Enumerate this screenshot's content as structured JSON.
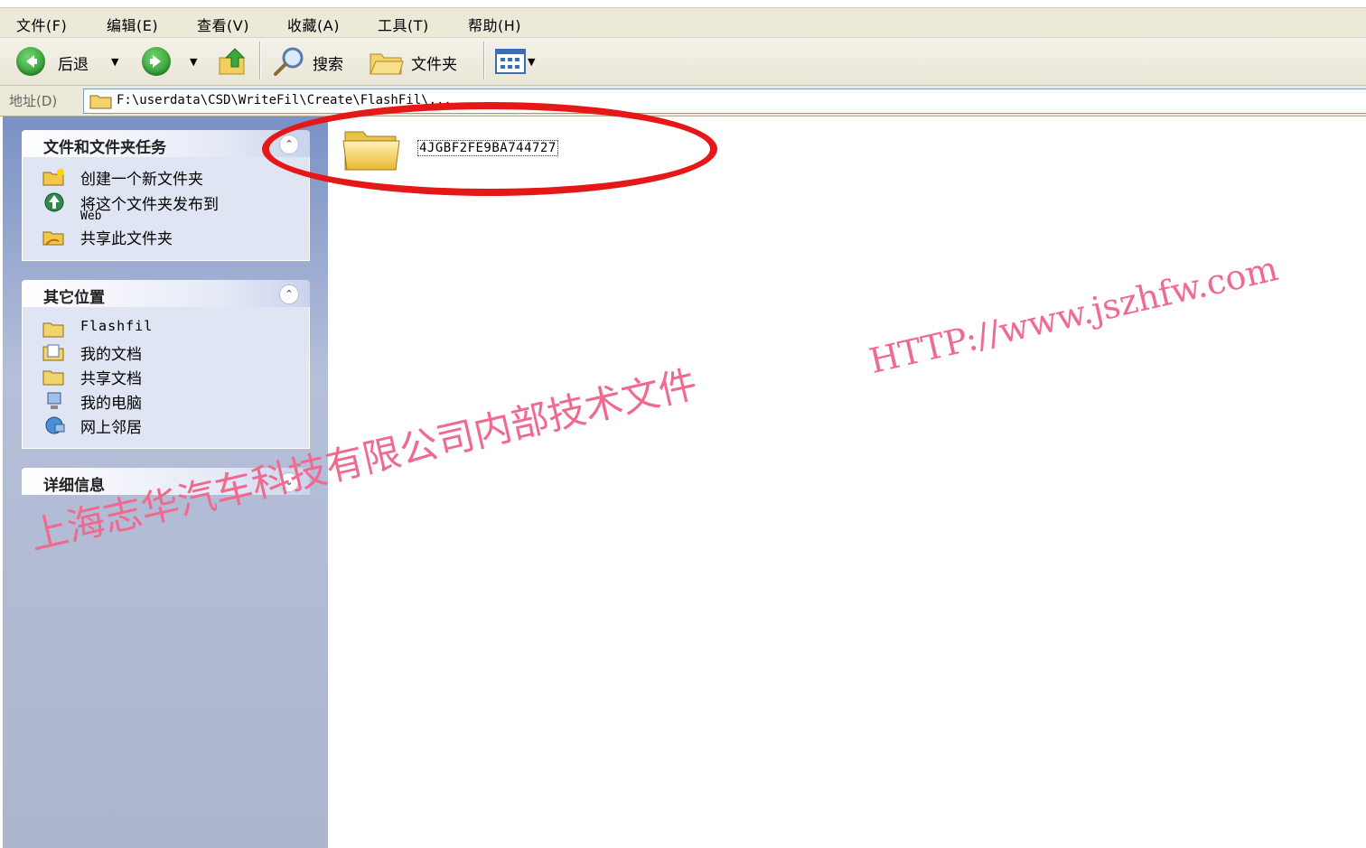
{
  "menu": {
    "file": "文件(F)",
    "edit": "编辑(E)",
    "view": "查看(V)",
    "favorites": "收藏(A)",
    "tools": "工具(T)",
    "help": "帮助(H)"
  },
  "toolbar": {
    "back_label": "后退",
    "search_label": "搜索",
    "folders_label": "文件夹"
  },
  "address": {
    "label": "地址(D)",
    "path": "F:\\userdata\\CSD\\WriteFil\\Create\\FlashFil\\..."
  },
  "sidebar": {
    "tasks_title": "文件和文件夹任务",
    "tasks": [
      {
        "label": "创建一个新文件夹",
        "icon": "new-folder-icon"
      },
      {
        "label": "将这个文件夹发布到",
        "sub": "Web",
        "icon": "publish-web-icon"
      },
      {
        "label": "共享此文件夹",
        "icon": "share-folder-icon"
      }
    ],
    "places_title": "其它位置",
    "places": [
      {
        "label": "Flashfil",
        "icon": "folder-icon"
      },
      {
        "label": "我的文档",
        "icon": "my-documents-icon"
      },
      {
        "label": "共享文档",
        "icon": "folder-icon"
      },
      {
        "label": "我的电脑",
        "icon": "my-computer-icon"
      },
      {
        "label": "网上邻居",
        "icon": "network-icon"
      }
    ],
    "details_title": "详细信息"
  },
  "content": {
    "folder_name": "4JGBF2FE9BA744727"
  },
  "watermark": {
    "company": "上海志华汽车科技有限公司内部技术文件",
    "url": "HTTP://www.jszhfw.com"
  },
  "colors": {
    "highlight_ellipse": "#e61717",
    "watermark": "#f06a8f",
    "sidebar": "#7a91c6"
  }
}
